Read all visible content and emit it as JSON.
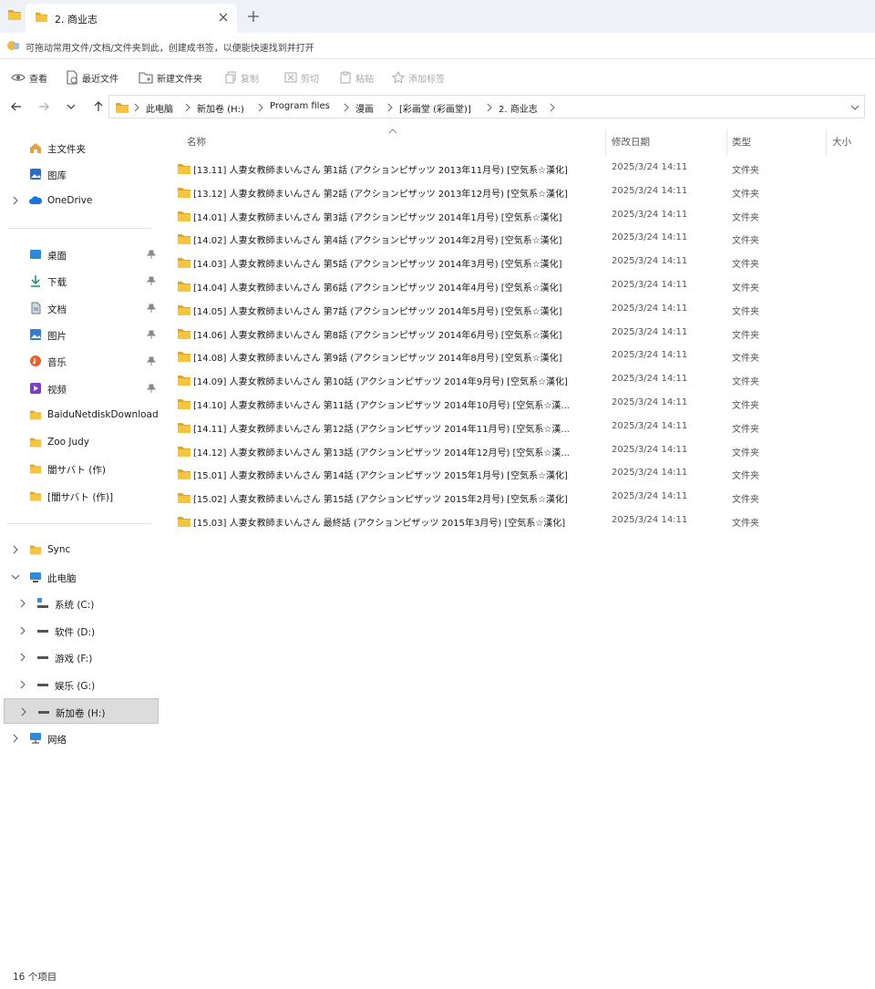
{
  "window": {
    "tab_title": "2. 商业志",
    "bookmark_hint": "可拖动常用文件/文档/文件夹到此，创建成书签，以便能快速找到并打开"
  },
  "toolbar": {
    "view": "查看",
    "recent": "最近文件",
    "new_folder": "新建文件夹",
    "copy": "复制",
    "cut": "剪切",
    "paste": "粘贴",
    "add_tag": "添加标签"
  },
  "breadcrumb": [
    "此电脑",
    "新加卷 (H:)",
    "Program files",
    "漫画",
    "[彩画堂 (彩画堂)]",
    "2. 商业志"
  ],
  "sidebar": {
    "home": "主文件夹",
    "gallery": "图库",
    "onedrive": "OneDrive",
    "desktop": "桌面",
    "downloads": "下载",
    "documents": "文档",
    "pictures": "图片",
    "music": "音乐",
    "videos": "视频",
    "baidu": "BaiduNetdiskDownload",
    "zoo": "Zoo Judy",
    "f1": "闇サバト (作)",
    "f2": "[闇サバト (作)]",
    "sync": "Sync",
    "thispc": "此电脑",
    "c": "系统 (C:)",
    "d": "软件 (D:)",
    "f": "游戏 (F:)",
    "g": "娱乐 (G:)",
    "h": "新加卷 (H:)",
    "network": "网络"
  },
  "columns": {
    "name": "名称",
    "modified": "修改日期",
    "type": "类型",
    "size": "大小"
  },
  "files": [
    {
      "name": "[13.11] 人妻女教師まいんさん 第1話 (アクションピザッツ 2013年11月号) [空気系☆漢化]",
      "date": "2025/3/24 14:11",
      "type": "文件夹"
    },
    {
      "name": "[13.12] 人妻女教師まいんさん 第2話 (アクションピザッツ 2013年12月号) [空気系☆漢化]",
      "date": "2025/3/24 14:11",
      "type": "文件夹"
    },
    {
      "name": "[14.01] 人妻女教師まいんさん 第3話 (アクションピザッツ 2014年1月号) [空気系☆漢化]",
      "date": "2025/3/24 14:11",
      "type": "文件夹"
    },
    {
      "name": "[14.02] 人妻女教師まいんさん 第4話 (アクションピザッツ 2014年2月号) [空気系☆漢化]",
      "date": "2025/3/24 14:11",
      "type": "文件夹"
    },
    {
      "name": "[14.03] 人妻女教師まいんさん 第5話 (アクションピザッツ 2014年3月号) [空気系☆漢化]",
      "date": "2025/3/24 14:11",
      "type": "文件夹"
    },
    {
      "name": "[14.04] 人妻女教師まいんさん 第6話 (アクションピザッツ 2014年4月号) [空気系☆漢化]",
      "date": "2025/3/24 14:11",
      "type": "文件夹"
    },
    {
      "name": "[14.05] 人妻女教師まいんさん 第7話 (アクションピザッツ 2014年5月号) [空気系☆漢化]",
      "date": "2025/3/24 14:11",
      "type": "文件夹"
    },
    {
      "name": "[14.06] 人妻女教師まいんさん 第8話 (アクションピザッツ 2014年6月号) [空気系☆漢化]",
      "date": "2025/3/24 14:11",
      "type": "文件夹"
    },
    {
      "name": "[14.08] 人妻女教師まいんさん 第9話 (アクションピザッツ 2014年8月号) [空気系☆漢化]",
      "date": "2025/3/24 14:11",
      "type": "文件夹"
    },
    {
      "name": "[14.09] 人妻女教師まいんさん 第10話 (アクションピザッツ 2014年9月号) [空気系☆漢化]",
      "date": "2025/3/24 14:11",
      "type": "文件夹"
    },
    {
      "name": "[14.10] 人妻女教師まいんさん 第11話 (アクションピザッツ 2014年10月号) [空気系☆漢...",
      "date": "2025/3/24 14:11",
      "type": "文件夹"
    },
    {
      "name": "[14.11] 人妻女教師まいんさん 第12話 (アクションピザッツ 2014年11月号) [空気系☆漢...",
      "date": "2025/3/24 14:11",
      "type": "文件夹"
    },
    {
      "name": "[14.12] 人妻女教師まいんさん 第13話 (アクションピザッツ 2014年12月号) [空気系☆漢...",
      "date": "2025/3/24 14:11",
      "type": "文件夹"
    },
    {
      "name": "[15.01] 人妻女教師まいんさん 第14話 (アクションピザッツ 2015年1月号) [空気系☆漢化]",
      "date": "2025/3/24 14:11",
      "type": "文件夹"
    },
    {
      "name": "[15.02] 人妻女教師まいんさん 第15話 (アクションピザッツ 2015年2月号) [空気系☆漢化]",
      "date": "2025/3/24 14:11",
      "type": "文件夹"
    },
    {
      "name": "[15.03] 人妻女教師まいんさん 最終話 (アクションピザッツ 2015年3月号) [空気系☆漢化]",
      "date": "2025/3/24 14:11",
      "type": "文件夹"
    }
  ],
  "status": {
    "count_text": "16 个项目"
  },
  "colors": {
    "folder": "#f5c542",
    "folder_dark": "#e0a82a",
    "selected": "#dcdcdc"
  },
  "icons": {
    "folder": "folder-icon",
    "pin": "pin-icon",
    "drive": "drive-icon"
  }
}
